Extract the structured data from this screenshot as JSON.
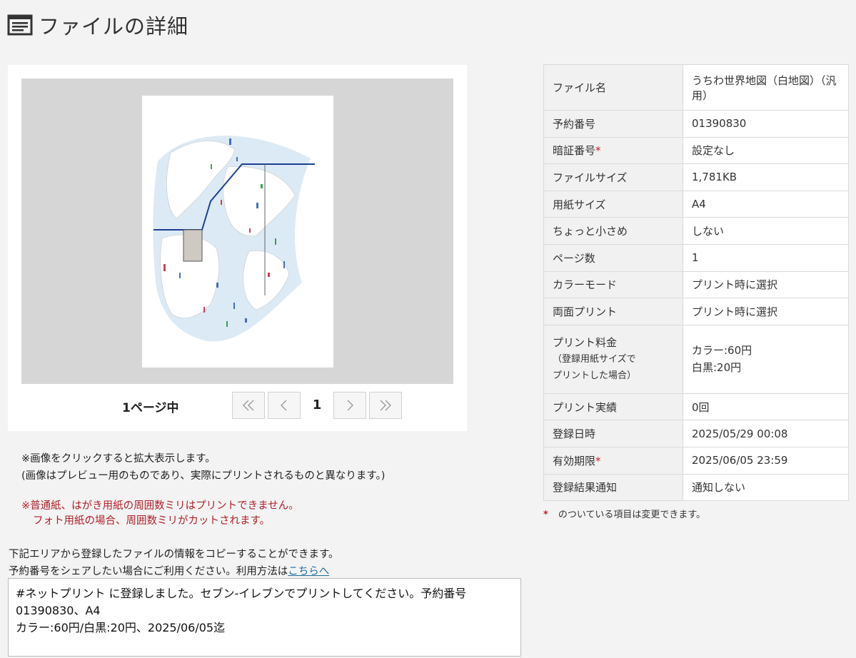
{
  "header": {
    "title": "ファイルの詳細",
    "icon": "document-list-icon"
  },
  "preview": {
    "page_count_label": "1ページ中",
    "current_page": "1",
    "buttons": [
      "first-page-icon",
      "prev-page-icon",
      "next-page-icon",
      "last-page-icon"
    ]
  },
  "notes": {
    "click_to_zoom": "※画像をクリックすると拡大表示します。",
    "preview_disclaimer": "(画像はプレビュー用のものであり、実際にプリントされるものと異なります。)",
    "margin_warning_1": "※普通紙、はがき用紙の周囲数ミリはプリントできません。",
    "margin_warning_2": "フォト用紙の場合、周囲数ミリがカットされます。"
  },
  "copy_section": {
    "line1": "下記エリアから登録したファイルの情報をコピーすることができます。",
    "line2_prefix": "予約番号をシェアしたい場合にご利用ください。利用方法は",
    "link_text": "こちらへ",
    "share_text": "#ネットプリント に登録しました。セブン-イレブンでプリントしてください。予約番号01390830、A4\nカラー:60円/白黒:20円、2025/06/05迄"
  },
  "details": {
    "file_name": {
      "label": "ファイル名",
      "value": "うちわ世界地図（白地図）（汎用）"
    },
    "reservation_number": {
      "label": "予約番号",
      "value": "01390830"
    },
    "pin": {
      "label": "暗証番号",
      "value": "設定なし"
    },
    "file_size": {
      "label": "ファイルサイズ",
      "value": "1,781KB"
    },
    "paper_size": {
      "label": "用紙サイズ",
      "value": "A4"
    },
    "slightly_smaller": {
      "label": "ちょっと小さめ",
      "value": "しない"
    },
    "page_count": {
      "label": "ページ数",
      "value": "1"
    },
    "color_mode": {
      "label": "カラーモード",
      "value": "プリント時に選択"
    },
    "duplex": {
      "label": "両面プリント",
      "value": "プリント時に選択"
    },
    "price": {
      "label": "プリント料金",
      "sub_label_1": "（登録用紙サイズで",
      "sub_label_2": "プリントした場合）",
      "value_color": "カラー:60円",
      "value_mono": "白黒:20円"
    },
    "print_count": {
      "label": "プリント実績",
      "value": "0回"
    },
    "registered_at": {
      "label": "登録日時",
      "value": "2025/05/29 00:08"
    },
    "expiry": {
      "label": "有効期限",
      "value": "2025/06/05 23:59"
    },
    "notify": {
      "label": "登録結果通知",
      "value": "通知しない"
    }
  },
  "required_mark": "*",
  "legend_text": "のついている項目は変更できます。",
  "colors": {
    "required": "#c4202c",
    "link": "#1f6fa0",
    "warning": "#b0202a"
  }
}
